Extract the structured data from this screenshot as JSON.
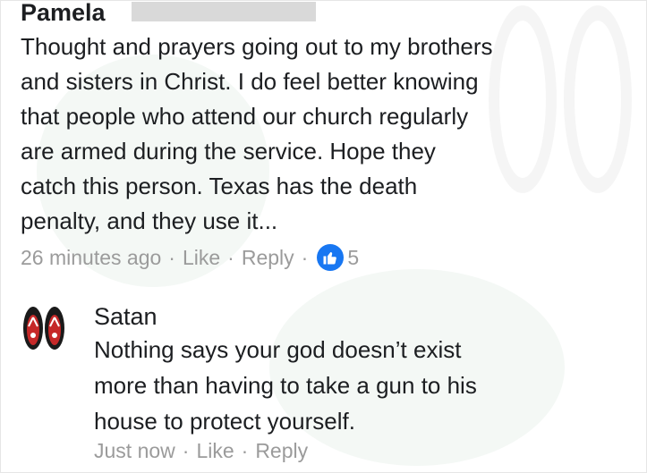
{
  "top_comment": {
    "author": "Pamela",
    "text": "Thought and prayers going out to my brothers\nand sisters in Christ. I do feel better knowing\nthat people who attend our church regularly\nare armed during the service. Hope they\ncatch this person. Texas has the death\npenalty, and they use it...",
    "time": "26 minutes ago",
    "like_label": "Like",
    "reply_label": "Reply",
    "separator": "·",
    "reaction_count": "5",
    "reaction_icon": "thumbs-up-icon"
  },
  "reply": {
    "author": "Satan",
    "avatar_icon": "flip-flops-avatar",
    "text": "Nothing says your god doesn’t exist\nmore than having to take a gun to his\nhouse to protect yourself.",
    "time": "Just now",
    "like_label": "Like",
    "reply_label": "Reply",
    "separator": "·"
  },
  "colors": {
    "text": "#1c1e21",
    "meta": "#9b9b9b",
    "like_badge": "#1877f2",
    "redaction": "#d9d9d9"
  }
}
